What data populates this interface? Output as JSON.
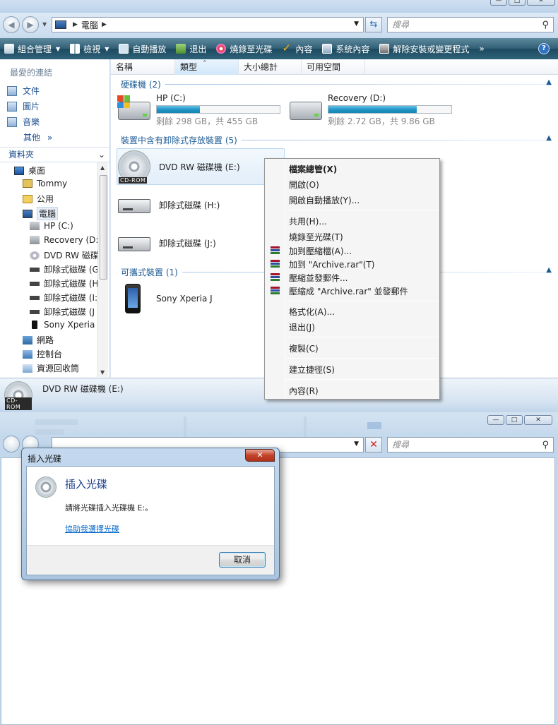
{
  "explorer": {
    "address": {
      "crumb": "電腦"
    },
    "search_placeholder": "搜尋",
    "toolbar": {
      "organize": "組合管理",
      "views": "檢視",
      "autoplay": "自動播放",
      "eject": "退出",
      "burn": "燒錄至光碟",
      "properties": "內容",
      "system_properties": "系統內容",
      "uninstall": "解除安裝或變更程式",
      "more": "»"
    },
    "nav": {
      "favorites_header": "最愛的連結",
      "favorites": [
        "文件",
        "圖片",
        "音樂"
      ],
      "more": "其他",
      "more_chevron": "»",
      "folders_header": "資料夾",
      "tree": [
        "桌面",
        "Tommy",
        "公用",
        "電腦",
        "HP (C:)",
        "Recovery (D:)",
        "DVD RW 磁碟",
        "卸除式磁碟 (G",
        "卸除式磁碟 (H",
        "卸除式磁碟 (I:",
        "卸除式磁碟 (J",
        "Sony Xperia .",
        "網路",
        "控制台",
        "資源回收筒"
      ]
    },
    "columns": [
      "名稱",
      "類型",
      "大小總計",
      "可用空間"
    ],
    "groups": {
      "hard_disks": "硬碟機 (2)",
      "removable": "裝置中含有卸除式存放裝置 (5)",
      "portable": "可攜式裝置 (1)"
    },
    "drives": [
      {
        "name": "HP (C:)",
        "free": "剩餘 298 GB，共 455 GB",
        "used_fraction": 0.35
      },
      {
        "name": "Recovery (D:)",
        "free": "剩餘 2.72 GB，共 9.86 GB",
        "used_fraction": 0.72
      }
    ],
    "removable_items": [
      "DVD RW 磁碟機 (E:)",
      "卸除式磁碟 (H:)",
      "卸除式磁碟 (J:)"
    ],
    "cdrom_label": "CD-ROM",
    "portable_items": [
      "Sony Xperia J"
    ],
    "details_name": "DVD RW 磁碟機 (E:)"
  },
  "context_menu": {
    "items": [
      "檔案總管(X)",
      "開啟(O)",
      "開啟自動播放(Y)...",
      "共用(H)...",
      "燒錄至光碟(T)",
      "加到壓縮檔(A)...",
      "加到 \"Archive.rar\"(T)",
      "壓縮並發郵件...",
      "壓縮成 \"Archive.rar\" 並發郵件",
      "格式化(A)...",
      "退出(J)",
      "複製(C)",
      "建立捷徑(S)",
      "內容(R)"
    ]
  },
  "explorer2": {
    "search_placeholder": "搜尋"
  },
  "dialog": {
    "title": "插入光碟",
    "heading": "插入光碟",
    "message": "請將光碟插入光碟機 E:。",
    "help_link": "協助我選擇光碟",
    "cancel": "取消"
  },
  "colors": {
    "toolbar": "#2f5d74",
    "link": "#1a4d8d",
    "accent": "#1b5a94",
    "close": "#c4432a"
  }
}
